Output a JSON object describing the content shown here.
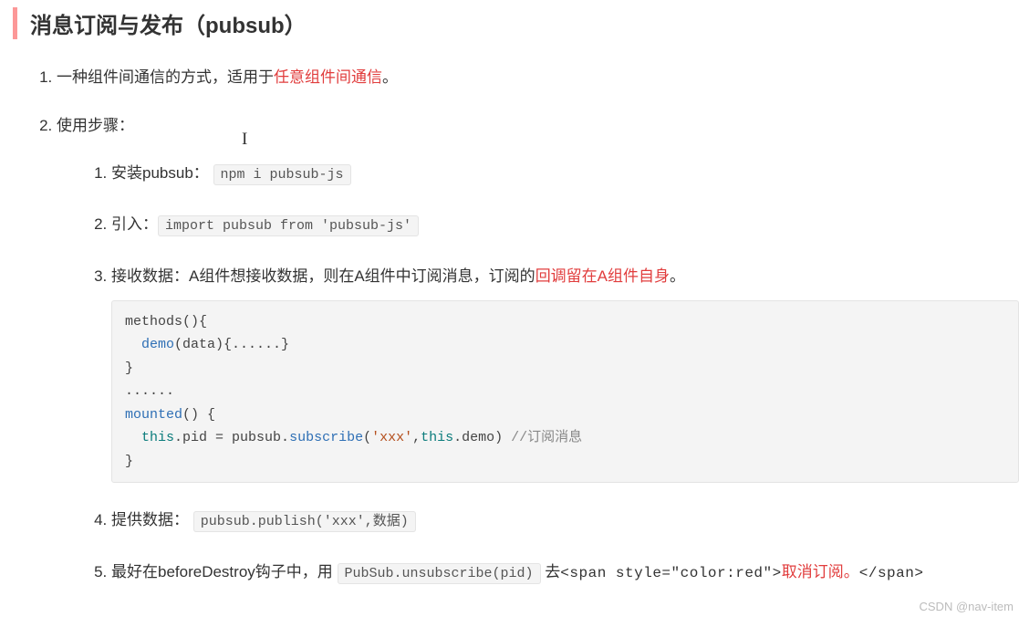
{
  "heading": "消息订阅与发布（pubsub）",
  "list": {
    "item1_prefix": "一种组件间通信的方式，适用于",
    "item1_highlight": "任意组件间通信",
    "item1_suffix": "。",
    "item2": "使用步骤：",
    "sub": {
      "s1_label": "安装pubsub：",
      "s1_code": "npm i pubsub-js",
      "s2_label": "引入：",
      "s2_code": "import pubsub from 'pubsub-js'",
      "s3_label": "接收数据：A组件想接收数据，则在A组件中订阅消息，订阅的",
      "s3_highlight": "回调留在A组件自身",
      "s3_suffix": "。",
      "s3_code_l1": "methods(){",
      "s3_code_l2a": "  demo",
      "s3_code_l2b": "(data){......}",
      "s3_code_l3": "}",
      "s3_code_l4": "......",
      "s3_code_l5a": "mounted",
      "s3_code_l5b": "() {",
      "s3_code_l6a": "  ",
      "s3_code_l6b": "this",
      "s3_code_l6c": ".pid = pubsub.",
      "s3_code_l6d": "subscribe",
      "s3_code_l6e": "(",
      "s3_code_l6f": "'xxx'",
      "s3_code_l6g": ",",
      "s3_code_l6h": "this",
      "s3_code_l6i": ".demo) ",
      "s3_code_l6j": "//订阅消息",
      "s3_code_l7": "}",
      "s4_label": "提供数据：",
      "s4_code": "pubsub.publish('xxx',数据)",
      "s5_prefix": "最好在beforeDestroy钩子中，用",
      "s5_code": "PubSub.unsubscribe(pid)",
      "s5_mid1": "去",
      "s5_raw1": "<span style=\"color:red\">",
      "s5_highlight": "取消订阅。",
      "s5_raw2": "</span>"
    }
  },
  "cursor_glyph": "I",
  "watermark": "CSDN @nav-item"
}
